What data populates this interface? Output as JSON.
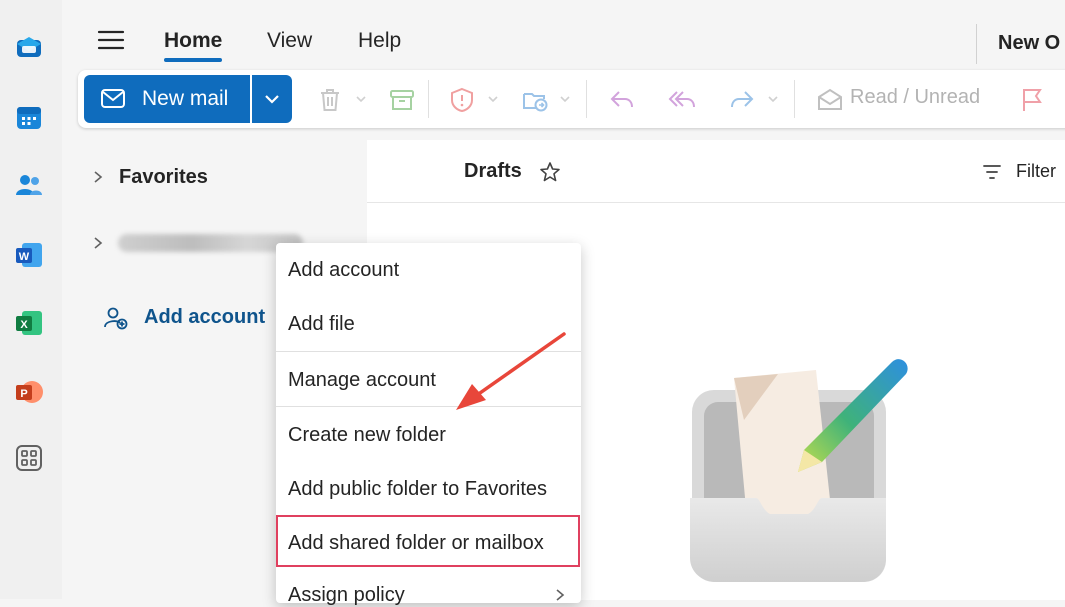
{
  "app": {
    "accent": "#0f6cbd",
    "highlight": "#e0405f",
    "arrow_color": "#e8463a"
  },
  "rail": {
    "items": [
      "mail-icon",
      "calendar-icon",
      "people-icon",
      "word-icon",
      "excel-icon",
      "powerpoint-icon",
      "apps-icon"
    ]
  },
  "tabs": {
    "menu_icon": "hamburger-icon",
    "home": "Home",
    "view": "View",
    "help": "Help",
    "new_outlook": "New O"
  },
  "ribbon": {
    "new_mail": "New mail",
    "read_unread": "Read / Unread",
    "icons": [
      "delete-icon",
      "archive-icon",
      "report-icon",
      "move-to-icon",
      "reply-icon",
      "reply-all-icon",
      "forward-icon",
      "envelope-icon",
      "flag-icon"
    ]
  },
  "folder_pane": {
    "favorites": "Favorites",
    "add_account": "Add account"
  },
  "list": {
    "title": "Drafts",
    "filter": "Filter"
  },
  "context_menu": {
    "items": [
      "Add account",
      "Add file",
      "Manage account",
      "Create new folder",
      "Add public folder to Favorites",
      "Add shared folder or mailbox",
      "Assign policy"
    ],
    "highlighted_item": "Add shared folder or mailbox"
  }
}
